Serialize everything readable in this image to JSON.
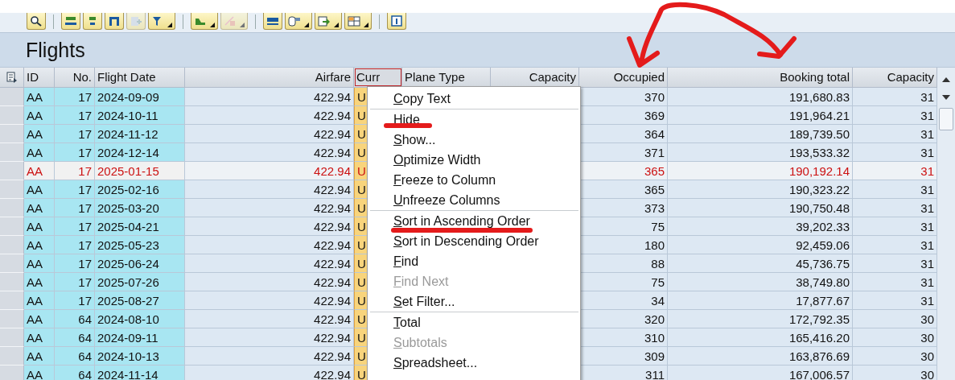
{
  "toolbar": [
    {
      "kind": "magnifier",
      "dropdown": false,
      "disabled": false,
      "group_start": false
    },
    {
      "kind": "bar",
      "dropdown": false,
      "disabled": false,
      "group_start": true
    },
    {
      "kind": "smallbar",
      "dropdown": false,
      "disabled": false,
      "group_start": false
    },
    {
      "kind": "columns",
      "dropdown": false,
      "disabled": false,
      "group_start": false
    },
    {
      "kind": "plus",
      "dropdown": false,
      "disabled": true,
      "group_start": false
    },
    {
      "kind": "funnel",
      "dropdown": true,
      "disabled": false,
      "group_start": false
    },
    {
      "kind": "chart",
      "dropdown": true,
      "disabled": false,
      "group_start": true
    },
    {
      "kind": "delete",
      "dropdown": true,
      "disabled": true,
      "group_start": false
    },
    {
      "kind": "display",
      "dropdown": false,
      "disabled": false,
      "group_start": true
    },
    {
      "kind": "layout",
      "dropdown": true,
      "disabled": false,
      "group_start": false
    },
    {
      "kind": "export",
      "dropdown": true,
      "disabled": false,
      "group_start": false
    },
    {
      "kind": "grid",
      "dropdown": true,
      "disabled": false,
      "group_start": false
    },
    {
      "kind": "info",
      "dropdown": false,
      "disabled": false,
      "group_start": true
    }
  ],
  "title": "Flights",
  "table": {
    "columns": [
      {
        "label": "ID",
        "selected": false
      },
      {
        "label": "No.",
        "selected": false
      },
      {
        "label": "Flight Date",
        "selected": false
      },
      {
        "label": "Airfare",
        "selected": false
      },
      {
        "label": "Curr",
        "selected": true
      },
      {
        "label": "Plane Type",
        "selected": false
      },
      {
        "label": "Capacity",
        "selected": false
      },
      {
        "label": "Occupied",
        "selected": false
      },
      {
        "label": "Booking total",
        "selected": false
      },
      {
        "label": "Capacity",
        "selected": false
      }
    ],
    "rows": [
      {
        "id": "AA",
        "no": "17",
        "date": "2024-09-09",
        "airfare": "422.94",
        "curr": "U",
        "occupied": "370",
        "total": "191,680.83",
        "capacity": "31",
        "highlighted": false
      },
      {
        "id": "AA",
        "no": "17",
        "date": "2024-10-11",
        "airfare": "422.94",
        "curr": "U",
        "occupied": "369",
        "total": "191,964.21",
        "capacity": "31",
        "highlighted": false
      },
      {
        "id": "AA",
        "no": "17",
        "date": "2024-11-12",
        "airfare": "422.94",
        "curr": "U",
        "occupied": "364",
        "total": "189,739.50",
        "capacity": "31",
        "highlighted": false
      },
      {
        "id": "AA",
        "no": "17",
        "date": "2024-12-14",
        "airfare": "422.94",
        "curr": "U",
        "occupied": "371",
        "total": "193,533.32",
        "capacity": "31",
        "highlighted": false
      },
      {
        "id": "AA",
        "no": "17",
        "date": "2025-01-15",
        "airfare": "422.94",
        "curr": "U",
        "occupied": "365",
        "total": "190,192.14",
        "capacity": "31",
        "highlighted": true
      },
      {
        "id": "AA",
        "no": "17",
        "date": "2025-02-16",
        "airfare": "422.94",
        "curr": "U",
        "occupied": "365",
        "total": "190,323.22",
        "capacity": "31",
        "highlighted": false
      },
      {
        "id": "AA",
        "no": "17",
        "date": "2025-03-20",
        "airfare": "422.94",
        "curr": "U",
        "occupied": "373",
        "total": "190,750.48",
        "capacity": "31",
        "highlighted": false
      },
      {
        "id": "AA",
        "no": "17",
        "date": "2025-04-21",
        "airfare": "422.94",
        "curr": "U",
        "occupied": "75",
        "total": "39,202.33",
        "capacity": "31",
        "highlighted": false
      },
      {
        "id": "AA",
        "no": "17",
        "date": "2025-05-23",
        "airfare": "422.94",
        "curr": "U",
        "occupied": "180",
        "total": "92,459.06",
        "capacity": "31",
        "highlighted": false
      },
      {
        "id": "AA",
        "no": "17",
        "date": "2025-06-24",
        "airfare": "422.94",
        "curr": "U",
        "occupied": "88",
        "total": "45,736.75",
        "capacity": "31",
        "highlighted": false
      },
      {
        "id": "AA",
        "no": "17",
        "date": "2025-07-26",
        "airfare": "422.94",
        "curr": "U",
        "occupied": "75",
        "total": "38,749.80",
        "capacity": "31",
        "highlighted": false
      },
      {
        "id": "AA",
        "no": "17",
        "date": "2025-08-27",
        "airfare": "422.94",
        "curr": "U",
        "occupied": "34",
        "total": "17,877.67",
        "capacity": "31",
        "highlighted": false
      },
      {
        "id": "AA",
        "no": "64",
        "date": "2024-08-10",
        "airfare": "422.94",
        "curr": "U",
        "occupied": "320",
        "total": "172,792.35",
        "capacity": "30",
        "highlighted": false
      },
      {
        "id": "AA",
        "no": "64",
        "date": "2024-09-11",
        "airfare": "422.94",
        "curr": "U",
        "occupied": "310",
        "total": "165,416.20",
        "capacity": "30",
        "highlighted": false
      },
      {
        "id": "AA",
        "no": "64",
        "date": "2024-10-13",
        "airfare": "422.94",
        "curr": "U",
        "occupied": "309",
        "total": "163,876.69",
        "capacity": "30",
        "highlighted": false
      },
      {
        "id": "AA",
        "no": "64",
        "date": "2024-11-14",
        "airfare": "422.94",
        "curr": "U",
        "occupied": "311",
        "total": "167,006.57",
        "capacity": "30",
        "highlighted": false
      }
    ]
  },
  "context_menu": {
    "groups": [
      [
        {
          "label": "Copy Text",
          "disabled": false
        }
      ],
      [
        {
          "label": "Hide",
          "disabled": false
        },
        {
          "label": "Show...",
          "disabled": false
        },
        {
          "label": "Optimize Width",
          "disabled": false
        },
        {
          "label": "Freeze to Column",
          "disabled": false
        },
        {
          "label": "Unfreeze Columns",
          "disabled": false
        }
      ],
      [
        {
          "label": "Sort in Ascending Order",
          "disabled": false
        },
        {
          "label": "Sort in Descending Order",
          "disabled": false
        },
        {
          "label": "Find",
          "disabled": false
        },
        {
          "label": "Find Next",
          "disabled": true
        },
        {
          "label": "Set Filter...",
          "disabled": false
        }
      ],
      [
        {
          "label": "Total",
          "disabled": false
        },
        {
          "label": "Subtotals",
          "disabled": true
        },
        {
          "label": "Spreadsheet...",
          "disabled": false
        }
      ]
    ]
  }
}
